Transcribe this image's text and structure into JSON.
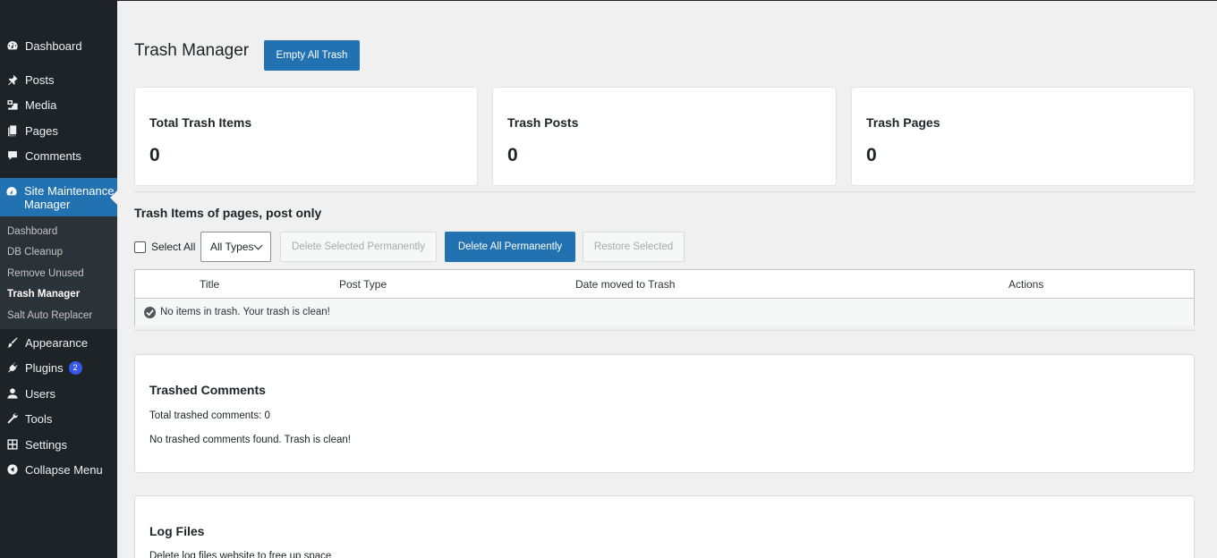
{
  "sidebar": {
    "items": [
      {
        "label": "Dashboard",
        "icon": "dashboard-icon"
      },
      {
        "label": "Posts",
        "icon": "pin-icon"
      },
      {
        "label": "Media",
        "icon": "media-icon"
      },
      {
        "label": "Pages",
        "icon": "pages-icon"
      },
      {
        "label": "Comments",
        "icon": "comment-icon"
      }
    ],
    "active": {
      "label": "Site Maintenance Manager",
      "icon": "gauge-icon"
    },
    "submenu": [
      "Dashboard",
      "DB Cleanup",
      "Remove Unused",
      "Trash Manager",
      "Salt Auto Replacer"
    ],
    "submenu_current": "Trash Manager",
    "bottom_items": [
      {
        "label": "Appearance",
        "icon": "brush-icon"
      },
      {
        "label": "Plugins",
        "icon": "plugin-icon",
        "badge": "2"
      },
      {
        "label": "Users",
        "icon": "user-icon"
      },
      {
        "label": "Tools",
        "icon": "wrench-icon"
      },
      {
        "label": "Settings",
        "icon": "settings-icon"
      },
      {
        "label": "Collapse Menu",
        "icon": "collapse-icon"
      }
    ]
  },
  "header": {
    "title": "Trash Manager",
    "empty_all_label": "Empty All Trash"
  },
  "cards": [
    {
      "title": "Total Trash Items",
      "value": "0"
    },
    {
      "title": "Trash Posts",
      "value": "0"
    },
    {
      "title": "Trash Pages",
      "value": "0"
    }
  ],
  "trash_section": {
    "title": "Trash Items of pages, post only",
    "select_all_label": "Select All",
    "type_filter": "All Types",
    "delete_selected_label": "Delete Selected Permanently",
    "delete_all_label": "Delete All Permanently",
    "restore_selected_label": "Restore Selected",
    "columns": [
      "Title",
      "Post Type",
      "Date moved to Trash",
      "Actions"
    ],
    "empty_message": "No items in trash. Your trash is clean!"
  },
  "comments_section": {
    "title": "Trashed Comments",
    "total_text": "Total trashed comments: 0",
    "empty_text": "No trashed comments found. Trash is clean!"
  },
  "logs_section": {
    "title": "Log Files",
    "description": "Delete log files website to free up space"
  },
  "colors": {
    "sidebar_bg": "#1d2327",
    "accent": "#2271b1",
    "badge": "#3858e9"
  }
}
